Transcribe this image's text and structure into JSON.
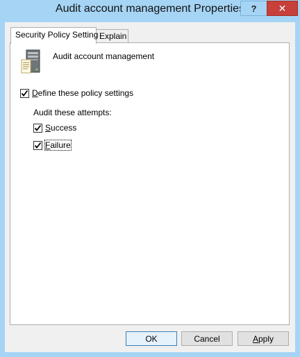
{
  "window": {
    "title": "Audit account management Properties",
    "help_label": "?",
    "close_label": "✕"
  },
  "tabs": [
    {
      "label": "Security Policy Setting",
      "active": true
    },
    {
      "label": "Explain",
      "active": false
    }
  ],
  "policy": {
    "name": "Audit account management",
    "icon": "policy-server-icon"
  },
  "define": {
    "label_mnemonic": "D",
    "label_rest": "efine these policy settings",
    "checked": true
  },
  "audit_group": {
    "label": "Audit these attempts:",
    "options": [
      {
        "mnemonic": "S",
        "rest": "uccess",
        "checked": true
      },
      {
        "mnemonic": "F",
        "rest": "ailure",
        "checked": true
      }
    ]
  },
  "buttons": {
    "ok": "OK",
    "cancel": "Cancel",
    "apply_mnemonic": "A",
    "apply_rest": "pply"
  },
  "colors": {
    "frame": "#a6d4f5",
    "close": "#c7403a",
    "client": "#f0f0f0",
    "default_button_border": "#3c7fb1"
  }
}
